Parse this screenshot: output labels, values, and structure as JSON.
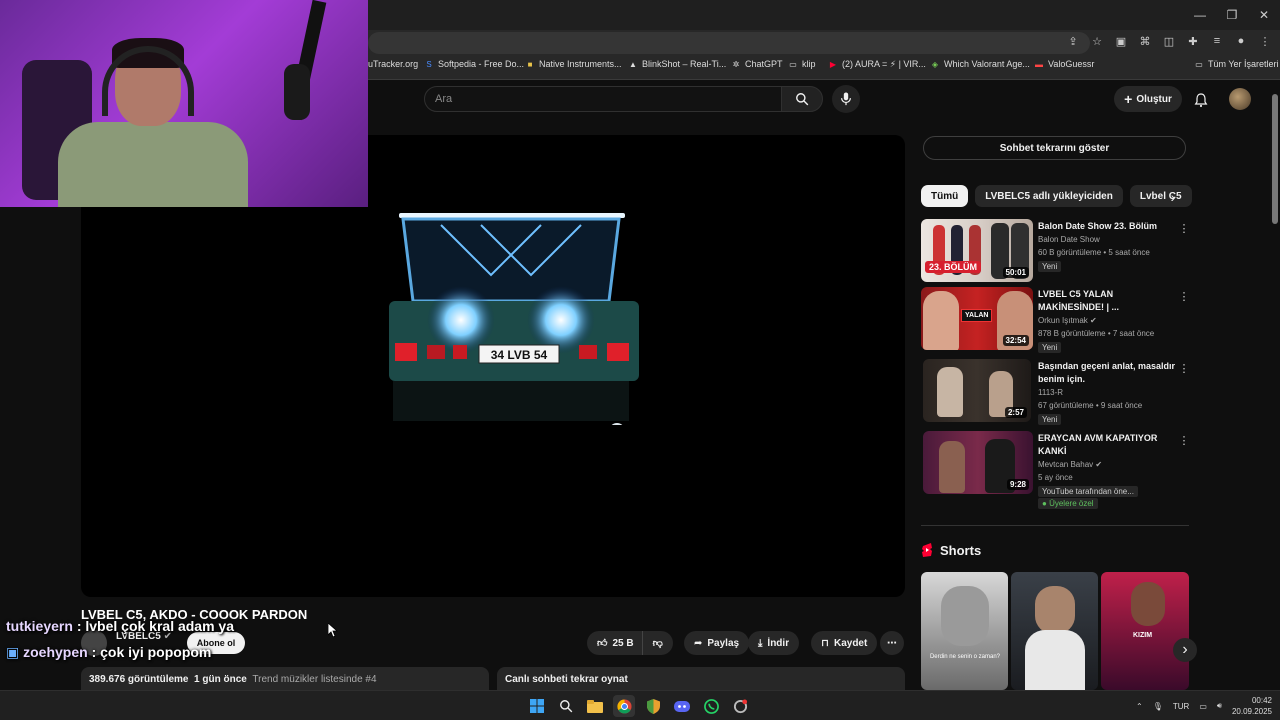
{
  "browser": {
    "bookmarks": [
      {
        "label": "uTracker.org"
      },
      {
        "label": "Softpedia - Free Do..."
      },
      {
        "label": "Native Instruments..."
      },
      {
        "label": "BlinkShot – Real-Ti..."
      },
      {
        "label": "ChatGPT"
      },
      {
        "label": "klip"
      },
      {
        "label": "(2) AURA = ⚡ | VIR..."
      },
      {
        "label": "Which Valorant Age..."
      },
      {
        "label": "ValoGuessr"
      }
    ],
    "all_bookmarks": "Tüm Yer İşaretleri"
  },
  "header": {
    "search_placeholder": "Ara",
    "create_label": "Oluştur"
  },
  "chat": [
    {
      "user": "tutkieyern",
      "message": ": lvbel çok kral adam ya"
    },
    {
      "user": "zoehypen",
      "message": ": çok iyi popopom"
    }
  ],
  "video": {
    "title": "LVBEL C5, AKDO - COOOK PARDON",
    "channel": "LVBELC5",
    "subscribe_label": "Abone ol",
    "likes": "25 B",
    "share_label": "Paylaş",
    "download_label": "İndir",
    "save_label": "Kaydet",
    "views": "389.676 görüntüleme",
    "age": "1 gün önce",
    "trend": "Trend müzikler listesinde #4",
    "replay_label": "Canlı sohbeti tekrar oynat",
    "plate": "34 LVB 54"
  },
  "sidebar": {
    "chat_replay_btn": "Sohbet tekrarını göster",
    "chips": [
      "Tümü",
      "LVBELC5 adlı yükleyiciden",
      "Lvbel C5"
    ],
    "recommendations": [
      {
        "title": "Balon Date Show 23. Bölüm",
        "channel": "Balon Date Show",
        "meta": "60 B görüntüleme • 5 saat önce",
        "badge": "Yeni",
        "duration": "50:01",
        "thumb_text": "23. BÖLÜM"
      },
      {
        "title": "LVBEL C5 YALAN MAKİNESİNDE! | ...",
        "channel": "Orkun Işıtmak",
        "meta": "878 B görüntüleme • 7 saat önce",
        "badge": "Yeni",
        "duration": "32:54",
        "thumb_text": "YALAN"
      },
      {
        "title": "Başından geçeni anlat, masaldır benim için.",
        "channel": "1113-R",
        "meta": "67 görüntüleme • 9 saat önce",
        "badge": "Yeni",
        "duration": "2:57"
      },
      {
        "title": "ERAYCAN AVM KAPATIYOR KANKİ",
        "channel": "Mevtcan Bahav",
        "meta": "5 ay önce",
        "badge": "YouTube tarafından öne...",
        "badge2": "Üyelere özel",
        "duration": "9:28"
      }
    ],
    "shorts_label": "Shorts",
    "shorts": [
      {
        "caption": "Derdin ne senin o zaman?"
      },
      {
        "caption": ""
      },
      {
        "caption": "KIZIM"
      }
    ]
  },
  "taskbar": {
    "lang": "TUR",
    "time": "00:42",
    "date": "20.09.2025"
  }
}
